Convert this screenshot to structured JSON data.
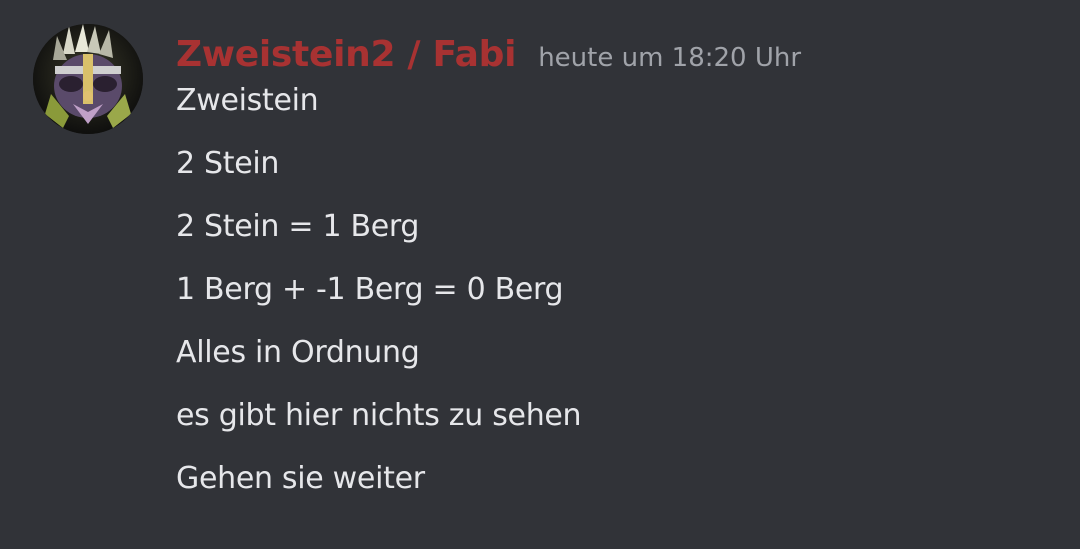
{
  "message": {
    "avatar_icon": "user-avatar-icon",
    "author": "Zweistein2 / Fabi",
    "author_color": "#a83232",
    "timestamp": "heute um 18:20 Uhr",
    "lines": [
      "Zweistein",
      "2 Stein",
      "2 Stein = 1 Berg",
      "1 Berg + -1 Berg = 0 Berg",
      "Alles in Ordnung",
      "es gibt hier nichts zu sehen",
      "Gehen sie weiter"
    ]
  },
  "colors": {
    "background": "#313338",
    "text": "#e6e7ea",
    "timestamp": "#a0a3a9"
  }
}
